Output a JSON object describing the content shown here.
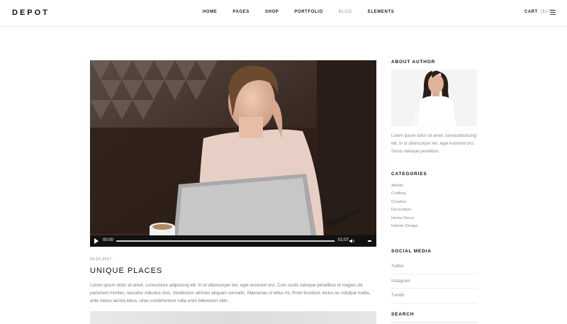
{
  "header": {
    "logo": "DEPOT",
    "nav": [
      {
        "label": "HOME",
        "active": false
      },
      {
        "label": "PAGES",
        "active": false
      },
      {
        "label": "SHOP",
        "active": false
      },
      {
        "label": "PORTFOLIO",
        "active": false
      },
      {
        "label": "BLOG",
        "active": true
      },
      {
        "label": "ELEMENTS",
        "active": false
      }
    ],
    "cart_label": "CART",
    "cart_total": "($375)",
    "menu_icon": "hamburger-icon"
  },
  "video": {
    "current_time": "00:00",
    "duration": "01:07",
    "play_icon": "play-icon",
    "volume_icon": "volume-icon"
  },
  "post": {
    "date": "03.02.2017.",
    "title": "UNIQUE PLACES",
    "excerpt": "Lorem ipsum dolor sit amet, consectetur adipiscing elit. In ut ullamcorper leo, eget euismod orci. Cum sociis natoque penatibus et magnis dis parturient montes, nascetur ridiculus mus. Vestibulum ultricies aliquam convallis. Maecenas ut tellus mi. Proin tincidunt, lectus eu volutpat mattis, ante metus lacinia tellus, vitae condimentum nulla enim bibendum nibh."
  },
  "sidebar": {
    "about_heading": "ABOUT AUTHOR",
    "about_text": "Lorem ipsum dolor sit amet, consectetulscing elit. In ut ullamcorper leo, eget euismod orci. Sociis natoque penatibus",
    "categories_heading": "CATEGORIES",
    "categories": [
      "Artistic",
      "Crafting",
      "Creative",
      "Decoration",
      "Home Decor",
      "Interior Design"
    ],
    "social_heading": "SOCIAL MEDIA",
    "social": [
      "Twitter",
      "Instagram",
      "Tumblr"
    ],
    "search_heading": "SEARCH"
  },
  "colors": {
    "active_nav": "#9a9a9a",
    "muted_text": "#8a8a8a",
    "player_bar": "#111111"
  }
}
